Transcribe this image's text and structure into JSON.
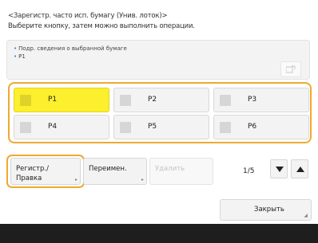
{
  "header": {
    "line1": "<Зарегистр. часто исп. бумагу (Унив. лоток)>",
    "line2": "Выберите кнопку, затем можно выполнить операции."
  },
  "info": {
    "line1": "Подр. сведения о выбранной бумаге",
    "line2": "P1"
  },
  "paper_buttons": [
    {
      "label": "P1",
      "selected": true
    },
    {
      "label": "P2",
      "selected": false
    },
    {
      "label": "P3",
      "selected": false
    },
    {
      "label": "P4",
      "selected": false
    },
    {
      "label": "P5",
      "selected": false
    },
    {
      "label": "P6",
      "selected": false
    }
  ],
  "actions": {
    "register_line1": "Регистр./",
    "register_line2": "Правка",
    "rename": "Переимен.",
    "delete": "Удалить"
  },
  "pager": {
    "text": "1/5"
  },
  "close_label": "Закрыть",
  "colors": {
    "selected": "#fbef2e",
    "highlight_frame": "#f0a830"
  }
}
